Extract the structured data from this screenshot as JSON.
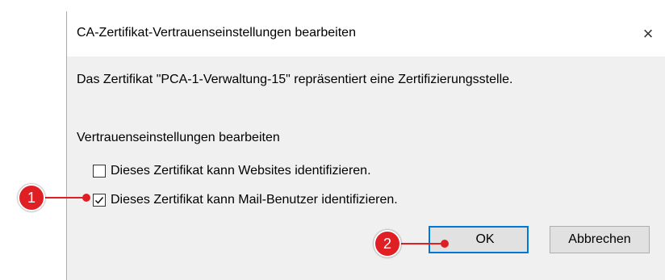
{
  "dialog": {
    "title": "CA-Zertifikat-Vertrauenseinstellungen bearbeiten",
    "close_icon": "×",
    "message": "Das Zertifikat \"PCA-1-Verwaltung-15\" repräsentiert eine Zertifizierungsstelle.",
    "section_label": "Vertrauenseinstellungen bearbeiten",
    "options": [
      {
        "label": "Dieses Zertifikat kann Websites identifizieren.",
        "checked": false
      },
      {
        "label": "Dieses Zertifikat kann Mail-Benutzer identifizieren.",
        "checked": true
      }
    ],
    "ok_label": "OK",
    "cancel_label": "Abbrechen"
  },
  "annotations": [
    {
      "number": "1"
    },
    {
      "number": "2"
    }
  ],
  "colors": {
    "marker": "#e01f25",
    "default_button_border": "#0078d7"
  }
}
